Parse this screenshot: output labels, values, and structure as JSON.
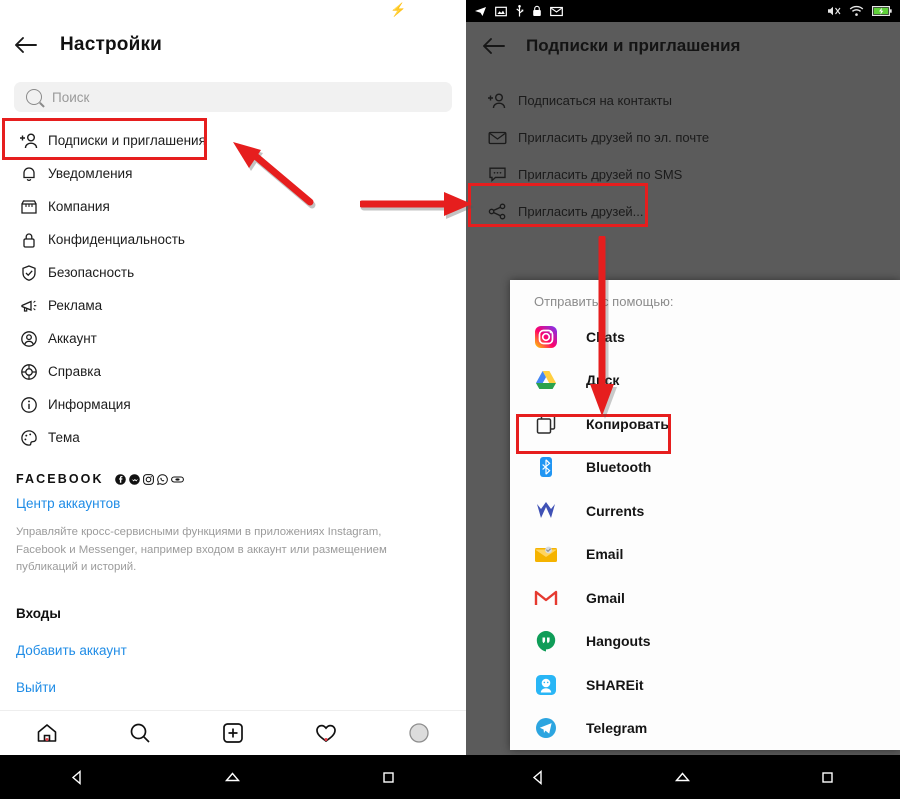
{
  "left_phone": {
    "status_bar": {
      "charging_icon": "lightning-bolt-icon"
    },
    "header": {
      "back_icon": "arrow-left-icon",
      "title": "Настройки"
    },
    "search": {
      "icon": "search-icon",
      "placeholder": "Поиск",
      "value": ""
    },
    "menu_items": [
      {
        "icon": "person-add-icon",
        "label": "Подписки и приглашения",
        "highlighted": true
      },
      {
        "icon": "bell-icon",
        "label": "Уведомления",
        "highlighted": false
      },
      {
        "icon": "storefront-icon",
        "label": "Компания",
        "highlighted": false
      },
      {
        "icon": "lock-icon",
        "label": "Конфиденциальность",
        "highlighted": false
      },
      {
        "icon": "shield-check-icon",
        "label": "Безопасность",
        "highlighted": false
      },
      {
        "icon": "megaphone-icon",
        "label": "Реклама",
        "highlighted": false
      },
      {
        "icon": "account-circle-icon",
        "label": "Аккаунт",
        "highlighted": false
      },
      {
        "icon": "lifebuoy-icon",
        "label": "Справка",
        "highlighted": false
      },
      {
        "icon": "info-circle-icon",
        "label": "Информация",
        "highlighted": false
      },
      {
        "icon": "palette-icon",
        "label": "Тема",
        "highlighted": false
      }
    ],
    "facebook_section": {
      "title": "FACEBOOK",
      "logo_icons": [
        "facebook-icon",
        "messenger-icon",
        "instagram-icon",
        "whatsapp-icon",
        "oculus-icon"
      ],
      "accounts_center_link": "Центр аккаунтов",
      "description": "Управляйте кросс-сервисными функциями в приложениях Instagram, Facebook и Messenger, например входом в аккаунт или размещением публикаций и историй.",
      "logins_title": "Входы",
      "add_account_link": "Добавить аккаунт",
      "logout_link": "Выйти"
    },
    "tab_bar": [
      {
        "icon": "home-icon",
        "badge": true
      },
      {
        "icon": "search-icon",
        "badge": false
      },
      {
        "icon": "plus-square-icon",
        "badge": false
      },
      {
        "icon": "heart-icon",
        "badge": true
      },
      {
        "icon": "avatar-icon",
        "badge": false
      }
    ],
    "nav_bar": [
      {
        "icon": "android-back-icon"
      },
      {
        "icon": "android-home-icon"
      },
      {
        "icon": "android-recents-icon"
      }
    ]
  },
  "right_phone": {
    "status_bar": {
      "left_icons": [
        "telegram-icon",
        "screenshot-icon",
        "usb-icon",
        "lock-icon",
        "email-icon"
      ],
      "right_icons": [
        "volume-mute-icon",
        "wifi-icon",
        "battery-charging-icon"
      ]
    },
    "header": {
      "back_icon": "arrow-left-icon",
      "title": "Подписки и приглашения"
    },
    "menu_items": [
      {
        "icon": "person-add-icon",
        "label": "Подписаться на контакты",
        "highlighted": false
      },
      {
        "icon": "envelope-icon",
        "label": "Пригласить друзей по эл. почте",
        "highlighted": false
      },
      {
        "icon": "sms-bubble-icon",
        "label": "Пригласить друзей по SMS",
        "highlighted": false
      },
      {
        "icon": "share-nodes-icon",
        "label": "Пригласить друзей...",
        "highlighted": true
      }
    ],
    "share_sheet": {
      "title": "Отправить с помощью:",
      "apps": [
        {
          "icon": "instagram-icon",
          "label": "Chats",
          "highlighted": false
        },
        {
          "icon": "google-drive-icon",
          "label": "Диск",
          "highlighted": false
        },
        {
          "icon": "copy-icon",
          "label": "Копировать",
          "highlighted": true
        },
        {
          "icon": "bluetooth-icon",
          "label": "Bluetooth",
          "highlighted": false
        },
        {
          "icon": "google-currents-icon",
          "label": "Currents",
          "highlighted": false
        },
        {
          "icon": "email-icon",
          "label": "Email",
          "highlighted": false
        },
        {
          "icon": "gmail-icon",
          "label": "Gmail",
          "highlighted": false
        },
        {
          "icon": "hangouts-icon",
          "label": "Hangouts",
          "highlighted": false
        },
        {
          "icon": "shareit-icon",
          "label": "SHAREit",
          "highlighted": false
        },
        {
          "icon": "telegram-icon",
          "label": "Telegram",
          "highlighted": false
        }
      ]
    },
    "nav_bar": [
      {
        "icon": "android-back-icon"
      },
      {
        "icon": "android-home-icon"
      },
      {
        "icon": "android-recents-icon"
      }
    ]
  },
  "annotations": {
    "accent_color": "#e61e1e",
    "arrows": [
      {
        "name": "arrow-to-subscriptions",
        "direction": "up-left"
      },
      {
        "name": "arrow-to-invite-friends",
        "direction": "right"
      },
      {
        "name": "arrow-to-copy",
        "direction": "down"
      }
    ]
  }
}
